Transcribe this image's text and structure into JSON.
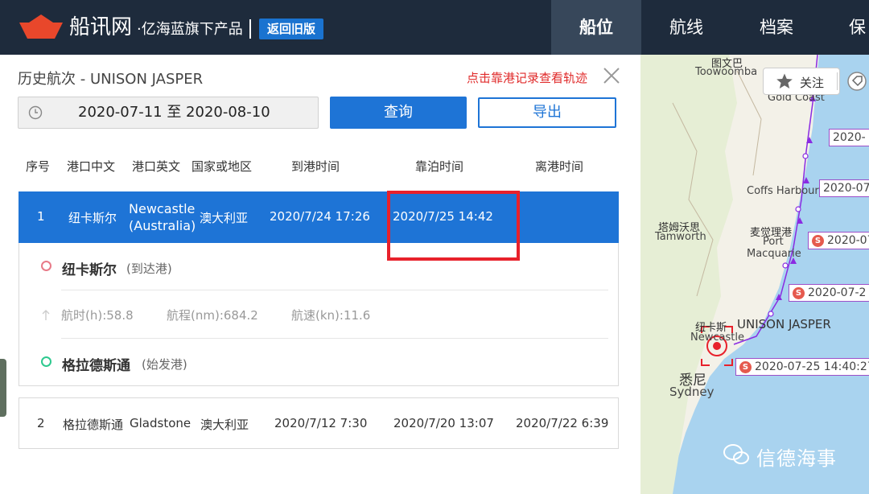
{
  "header": {
    "brand": "船讯网",
    "brand_sub": "·亿海蓝旗下产品",
    "old_version": "返回旧版",
    "nav": [
      "船位",
      "航线",
      "档案",
      "保"
    ],
    "colors": {
      "bar": "#1e2b3c",
      "active": "#37475a",
      "accent": "#1a73d0",
      "logo": "#e8472b"
    }
  },
  "panel": {
    "title": "历史航次 - UNISON JASPER",
    "track_hint": "点击靠港记录查看轨迹",
    "date_range": "2020-07-11 至 2020-08-10",
    "query_label": "查询",
    "export_label": "导出",
    "columns": [
      "序号",
      "港口中文",
      "港口英文",
      "国家或地区",
      "到港时间",
      "靠泊时间",
      "离港时间"
    ],
    "rows": [
      {
        "index": "1",
        "port_cn": "纽卡斯尔",
        "port_en_line1": "Newcastle",
        "port_en_line2": "(Australia)",
        "country": "澳大利亚",
        "arrival": "2020/7/24 17:26",
        "berth": "2020/7/25 14:42",
        "departure": ""
      },
      {
        "index": "2",
        "port_cn": "格拉德斯通",
        "port_en": "Gladstone",
        "country": "澳大利亚",
        "arrival": "2020/7/12 7:30",
        "berth": "2020/7/20 13:07",
        "departure": "2020/7/22 6:39"
      }
    ],
    "detail": {
      "arrival_port": "纽卡斯尔",
      "arrival_tag": "(到达港)",
      "start_port": "格拉德斯通",
      "start_tag": "(始发港)",
      "duration": "航时(h):58.8",
      "distance": "航程(nm):684.2",
      "speed": "航速(kn):11.6"
    }
  },
  "map": {
    "labels": {
      "toowoomba_cn": "图文巴",
      "toowoomba_en": "Toowoomba",
      "gold_coast": "Gold Coast",
      "coffs": "Coffs Harbour",
      "tamworth_cn": "塔姆沃思",
      "tamworth_en": "Tamworth",
      "pm_cn": "麦觉理港",
      "pm_en1": "Port",
      "pm_en2": "Macquarie",
      "newcastle_cn": "纽卡斯",
      "newcastle_en": "Newcastle",
      "sydney_cn": "悉尼",
      "sydney_en": "Sydney"
    },
    "ship_name": "UNISON JASPER",
    "follow_label": "关注",
    "track_labels": [
      "2020-",
      "2020-07",
      "2020-07",
      "2020-07-2",
      "2020-07-25 14:40:27"
    ],
    "badge": "S",
    "watermark": "信德海事"
  }
}
